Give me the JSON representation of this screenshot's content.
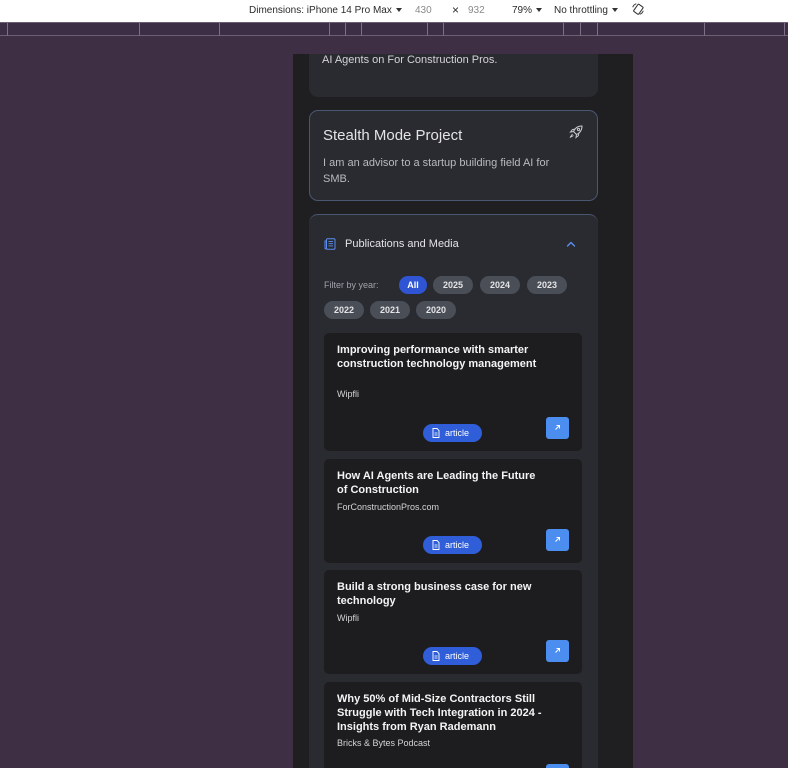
{
  "devtools": {
    "dimensions_label": "Dimensions: iPhone 14 Pro Max",
    "width": "430",
    "times": "×",
    "height": "932",
    "zoom": "79%",
    "throttling": "No throttling",
    "rotate_icon": "rotate-icon"
  },
  "previous_card": {
    "text": "AI Agents on For Construction Pros."
  },
  "stealth": {
    "title": "Stealth Mode Project",
    "description": "I am an advisor to a startup building field AI for SMB.",
    "icon": "rocket-icon"
  },
  "publications": {
    "title": "Publications and Media",
    "filter_label": "Filter by year:",
    "years": [
      "All",
      "2025",
      "2024",
      "2023",
      "2022",
      "2021",
      "2020"
    ],
    "selected_year": "All",
    "items": [
      {
        "title": "Improving performance with smarter construction technology management",
        "source": "Wipfli",
        "type": "article"
      },
      {
        "title": "How AI Agents are Leading the Future of Construction",
        "source": "ForConstructionPros.com",
        "type": "article"
      },
      {
        "title": "Build a strong business case for new technology",
        "source": "Wipfli",
        "type": "article"
      },
      {
        "title": "Why 50% of Mid-Size Contractors Still Struggle with Tech Integration in 2024 - Insights from Ryan Rademann",
        "source": "Bricks & Bytes Podcast",
        "type": ""
      }
    ]
  },
  "colors": {
    "accent": "#2f55d4",
    "external_button": "#4b8ef0",
    "background": "#3f2f45"
  }
}
